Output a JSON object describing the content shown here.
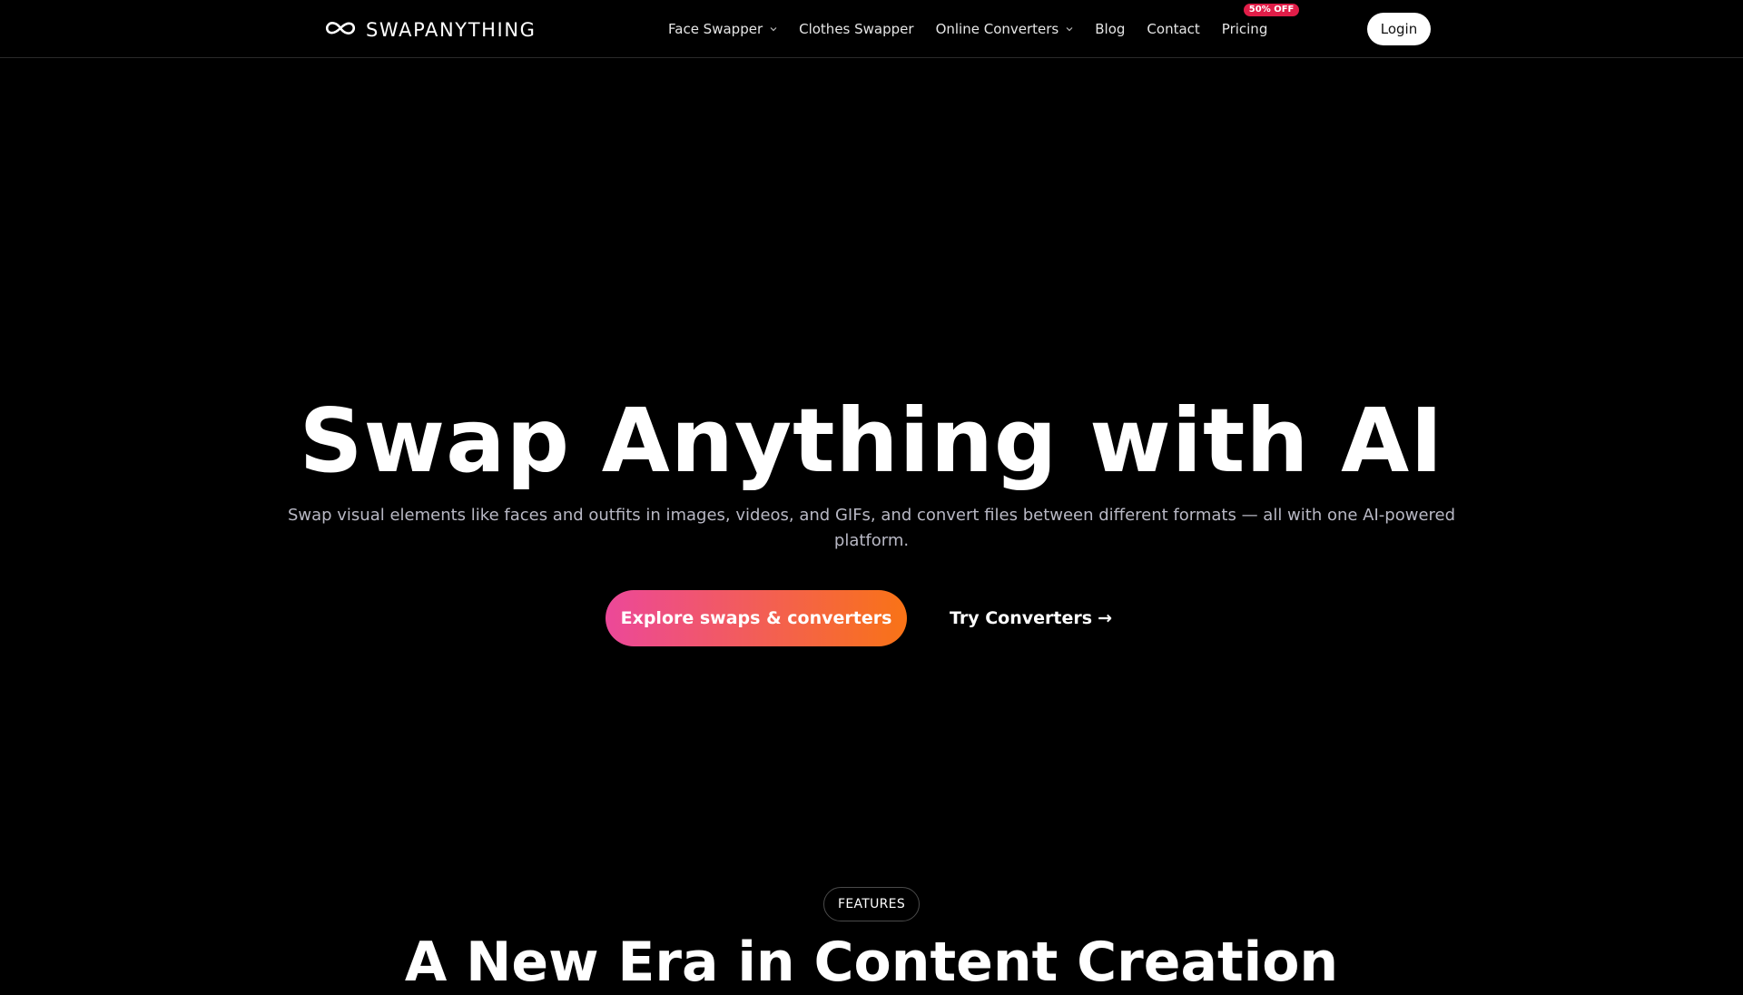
{
  "header": {
    "logo_text": "SWAPANYTHING",
    "logo_icon": "infinity-icon",
    "nav": [
      {
        "label": "Face Swapper",
        "dropdown": true
      },
      {
        "label": "Clothes Swapper",
        "dropdown": false
      },
      {
        "label": "Online Converters",
        "dropdown": true
      },
      {
        "label": "Blog",
        "dropdown": false
      },
      {
        "label": "Contact",
        "dropdown": false
      },
      {
        "label": "Pricing",
        "dropdown": false,
        "badge": "50% OFF"
      }
    ],
    "login_label": "Login"
  },
  "hero": {
    "title": "Swap Anything with AI",
    "subtitle": "Swap visual elements like faces and outfits in images, videos, and GIFs, and convert files between different formats — all with one AI-powered platform.",
    "primary_cta": "Explore swaps & converters",
    "secondary_cta": "Try Converters",
    "secondary_cta_arrow": "→"
  },
  "features": {
    "tag": "FEATURES",
    "title": "A New Era in Content Creation"
  },
  "colors": {
    "background": "#000000",
    "badge": "#e11d48",
    "gradient_start": "#ec4899",
    "gradient_end": "#f97316"
  }
}
